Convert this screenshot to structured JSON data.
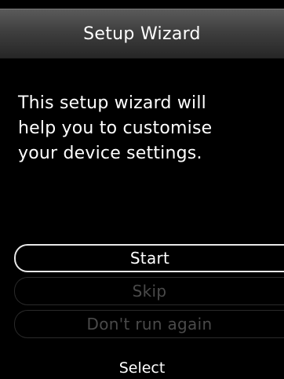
{
  "title_bar": {
    "title": "Setup Wizard"
  },
  "message": {
    "line1": "This setup wizard will",
    "line2": "help you to customise",
    "line3": "your device settings."
  },
  "options": [
    {
      "label": "Start",
      "state": "selected"
    },
    {
      "label": "Skip",
      "state": "disabled"
    },
    {
      "label": "Don't run again",
      "state": "disabled"
    }
  ],
  "softkey": {
    "center_label": "Select"
  },
  "colors": {
    "background": "#000000",
    "text": "#ffffff",
    "disabled_text": "#4a4a4a",
    "selected_border": "#e8e8e8"
  }
}
